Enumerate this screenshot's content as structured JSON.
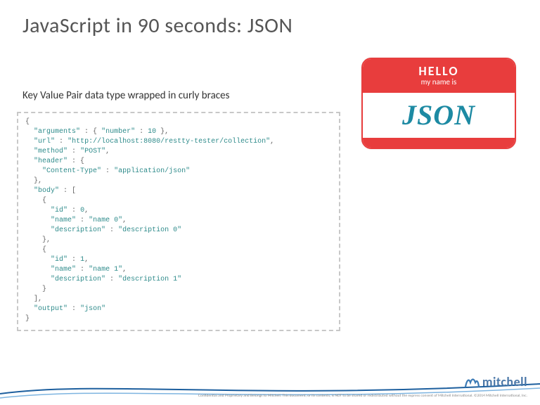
{
  "title": "JavaScript in 90 seconds: JSON",
  "subtitle": "Key Value Pair data type wrapped in curly braces",
  "badge": {
    "line1": "HELLO",
    "line2": "my name is",
    "name": "JSON"
  },
  "code": {
    "arguments_key": "\"arguments\"",
    "arguments_val_key": "\"number\"",
    "arguments_val_num": "10",
    "url_key": "\"url\"",
    "url_val": "\"http://localhost:8080/restty-tester/collection\"",
    "method_key": "\"method\"",
    "method_val": "\"POST\"",
    "header_key": "\"header\"",
    "ct_key": "\"Content-Type\"",
    "ct_val": "\"application/json\"",
    "body_key": "\"body\"",
    "id_key": "\"id\"",
    "id0": "0",
    "id1": "1",
    "name_key": "\"name\"",
    "name0": "\"name 0\"",
    "name1": "\"name 1\"",
    "desc_key": "\"description\"",
    "desc0": "\"description 0\"",
    "desc1": "\"description 1\"",
    "output_key": "\"output\"",
    "output_val": "\"json\""
  },
  "brand": "mitchell",
  "disclaimer": "Confidential and Proprietary and Belongs to Mitchell. This document, or its contents, is NOT to be shared or\nredistributed without the express consent of Mitchell International. ©2014 Mitchell International, Inc."
}
